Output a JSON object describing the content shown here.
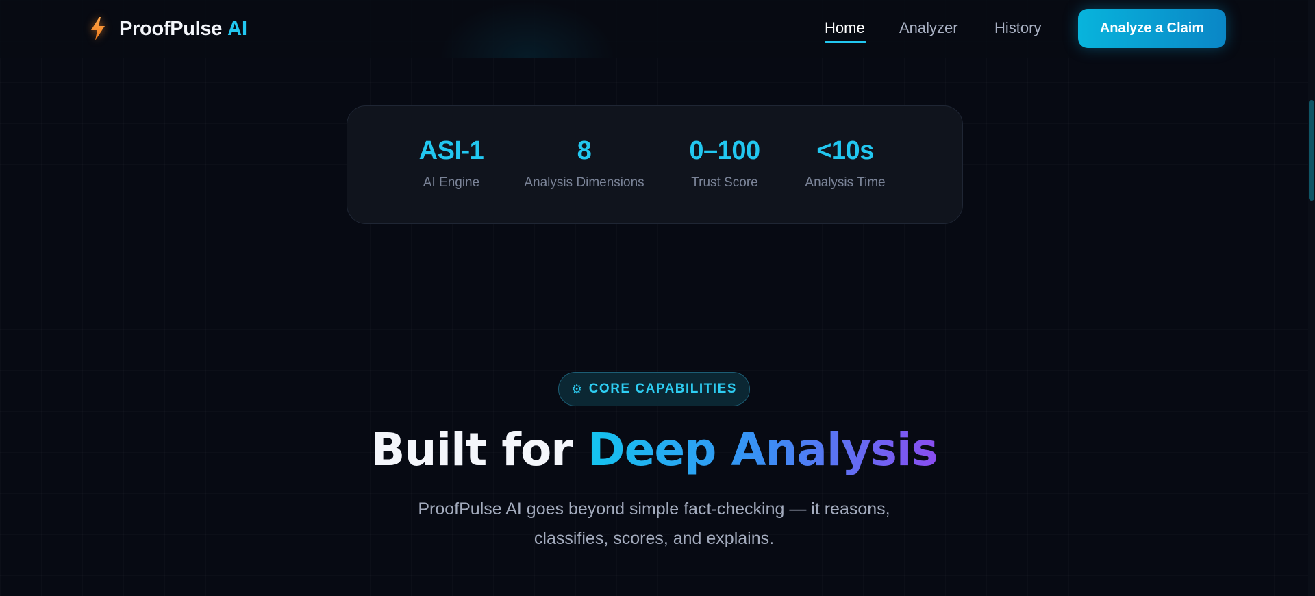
{
  "brand": {
    "name": "ProofPulse",
    "ai": "AI"
  },
  "nav": {
    "links": [
      {
        "label": "Home",
        "active": true
      },
      {
        "label": "Analyzer",
        "active": false
      },
      {
        "label": "History",
        "active": false
      }
    ],
    "cta_label": "Analyze a Claim"
  },
  "stats": [
    {
      "value": "ASI-1",
      "label": "AI Engine"
    },
    {
      "value": "8",
      "label": "Analysis Dimensions"
    },
    {
      "value": "0–100",
      "label": "Trust Score"
    },
    {
      "value": "<10s",
      "label": "Analysis Time"
    }
  ],
  "section": {
    "badge_icon": "⚙",
    "badge_label": "CORE CAPABILITIES",
    "headline_plain": "Built for ",
    "headline_accent": "Deep Analysis",
    "subtitle": "ProofPulse AI goes beyond simple fact-checking — it reasons, classifies, scores, and explains."
  },
  "colors": {
    "background": "#070a13",
    "accent": "#22c7f0",
    "gradient_end": "#8a4df0",
    "bolt": "#ff8a2a"
  }
}
